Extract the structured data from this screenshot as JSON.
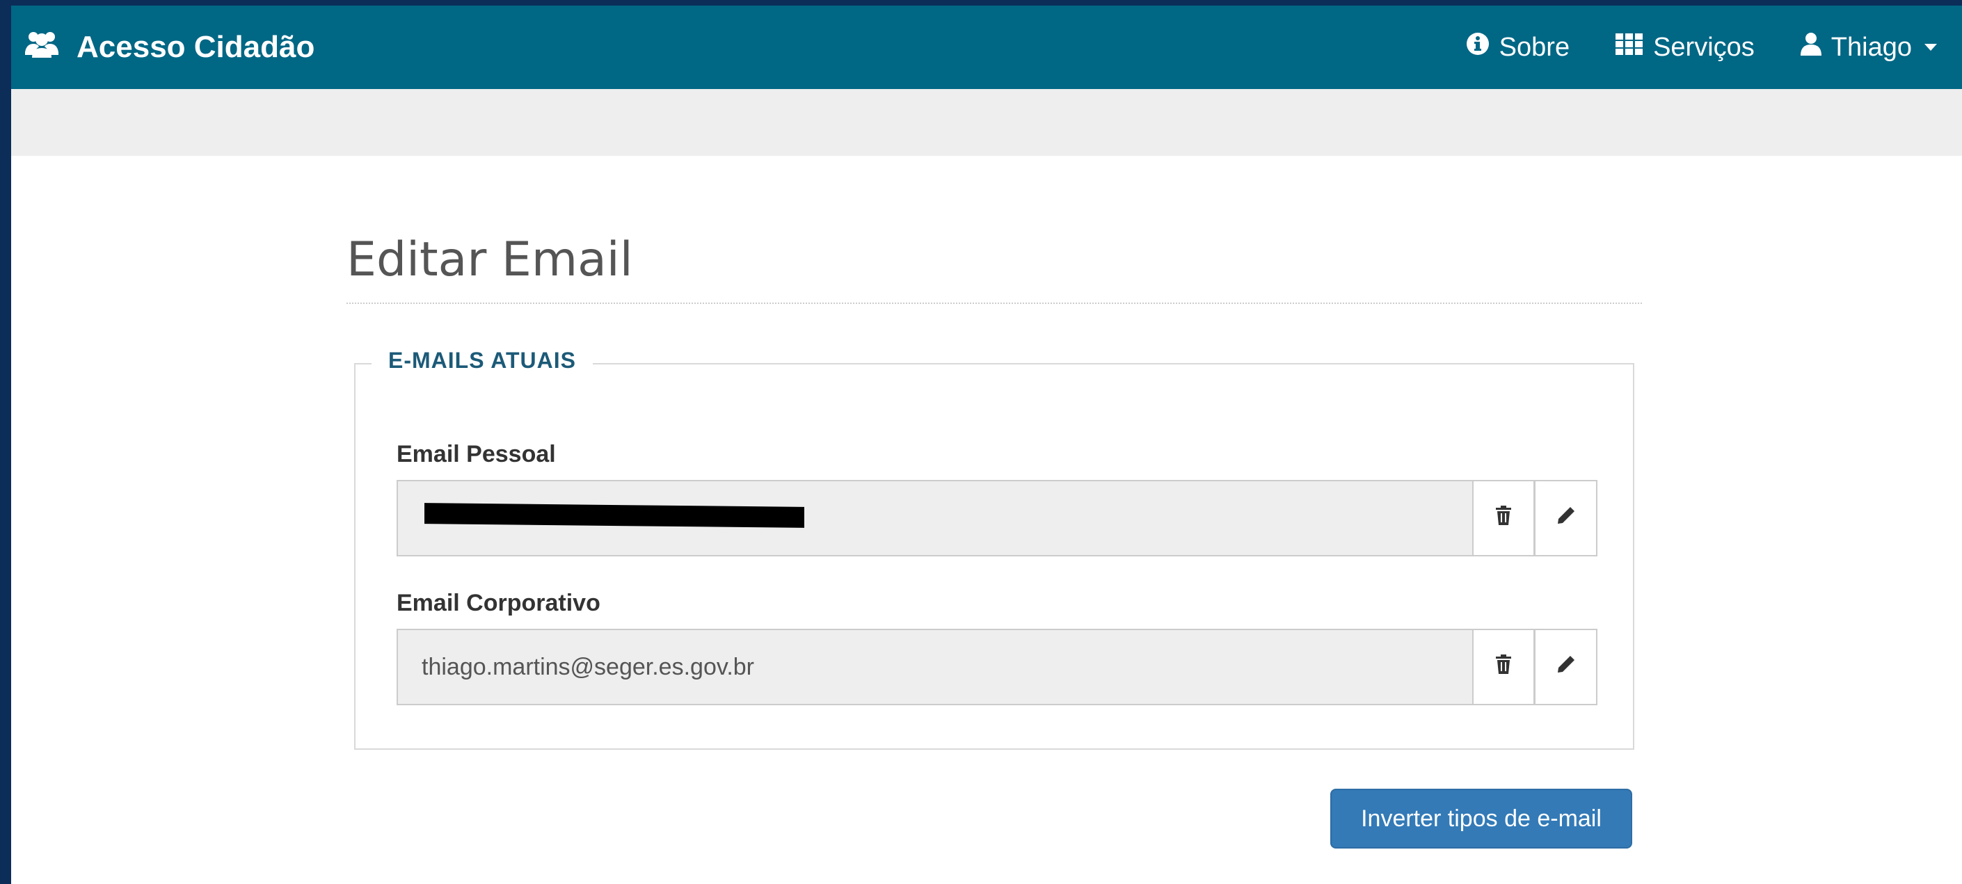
{
  "navbar": {
    "brand": "Acesso Cidadão",
    "items": [
      {
        "label": "Sobre",
        "icon": "info-circle-icon"
      },
      {
        "label": "Serviços",
        "icon": "grid-icon"
      },
      {
        "label": "Thiago",
        "icon": "user-icon"
      }
    ]
  },
  "page": {
    "title": "Editar Email"
  },
  "section": {
    "legend": "E-MAILS ATUAIS",
    "personal": {
      "label": "Email Pessoal",
      "value": ""
    },
    "corporate": {
      "label": "Email Corporativo",
      "value": "thiago.martins@seger.es.gov.br"
    }
  },
  "actions": {
    "swap_label": "Inverter tipos de e-mail"
  },
  "colors": {
    "navbar": "#006785",
    "legend": "#1c5a78",
    "primary": "#337ab7"
  }
}
